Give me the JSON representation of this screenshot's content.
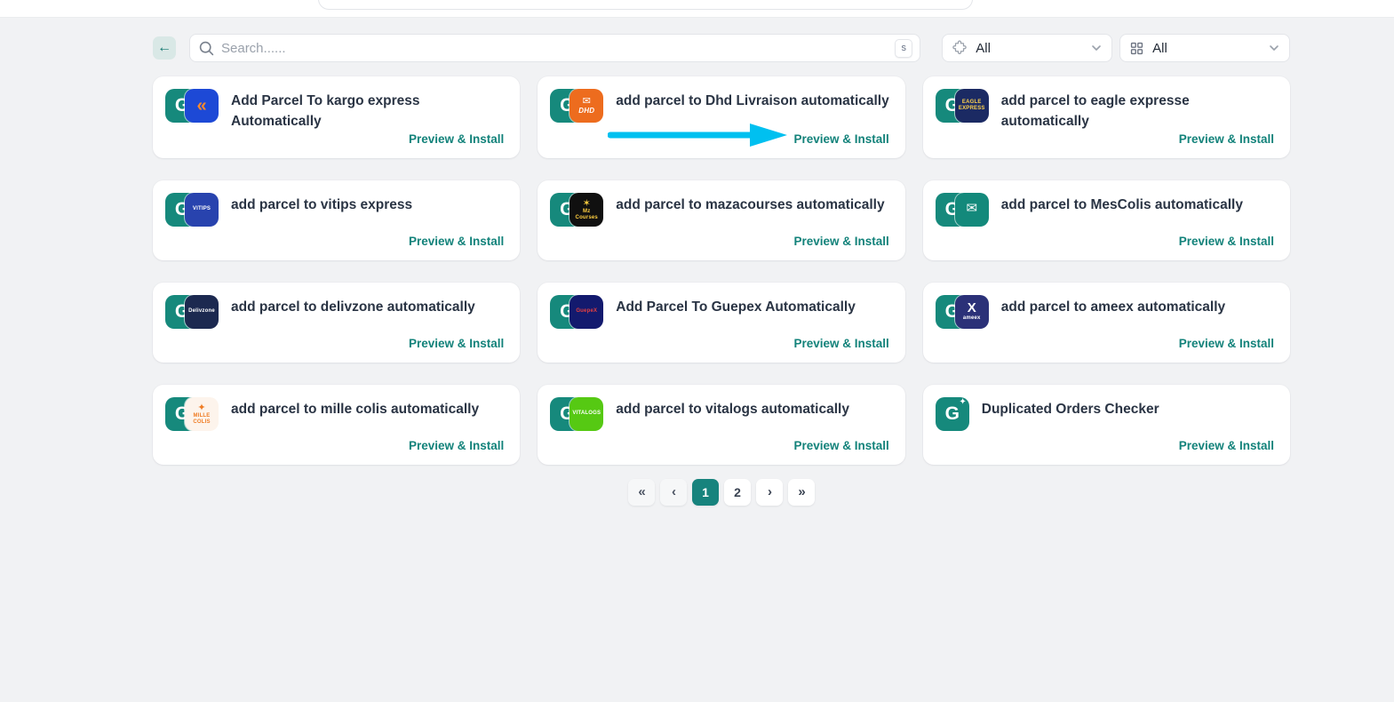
{
  "page": {
    "background": "#f1f2f4",
    "gitex_teal": "#16897c",
    "link_teal": "#12827a"
  },
  "topbar": {
    "back_label": "←",
    "search": {
      "placeholder": "Search......",
      "shortcut_key": "s"
    },
    "filters": [
      {
        "icon": "puzzle-icon",
        "value": "All"
      },
      {
        "icon": "grid-icon",
        "value": "All"
      }
    ]
  },
  "cards": [
    {
      "title": "Add Parcel To kargo express Automatically",
      "install_label": "Preview & Install",
      "partner": {
        "name": "kargo express",
        "bg": "#1d49d6",
        "fg": "#ff8a2a",
        "glyph": "«",
        "label": ""
      }
    },
    {
      "title": "add parcel to Dhd Livraison automatically",
      "install_label": "Preview & Install",
      "annotated": true,
      "partner": {
        "name": "Dhd Livraison",
        "bg": "#ed6c1e",
        "fg": "#ffffff",
        "glyph": "✉",
        "label": "DHD"
      }
    },
    {
      "title": "add parcel to eagle expresse automatically",
      "install_label": "Preview & Install",
      "partner": {
        "name": "eagle expresse",
        "bg": "#1b2a63",
        "fg": "#ffd34d",
        "glyph": "",
        "label": "EAGLE EXPRESS"
      }
    },
    {
      "title": "add parcel to vitips express",
      "install_label": "Preview & Install",
      "partner": {
        "name": "vitips express",
        "bg": "#2843ae",
        "fg": "#ffffff",
        "glyph": "",
        "label": "VITIPS"
      }
    },
    {
      "title": "add parcel to mazacourses automatically",
      "install_label": "Preview & Install",
      "partner": {
        "name": "mazacourses",
        "bg": "#101010",
        "fg": "#ffcf40",
        "glyph": "✶",
        "label": "Mz Courses"
      }
    },
    {
      "title": "add parcel to MesColis automatically",
      "install_label": "Preview & Install",
      "partner": {
        "name": "MesColis",
        "bg": "#13897b",
        "fg": "#ffffff",
        "glyph": "✉",
        "label": ""
      }
    },
    {
      "title": "add parcel to delivzone automatically",
      "install_label": "Preview & Install",
      "partner": {
        "name": "delivzone",
        "bg": "#1c2950",
        "fg": "#ffffff",
        "glyph": "",
        "label": "Delivzone"
      }
    },
    {
      "title": "Add Parcel To Guepex Automatically",
      "install_label": "Preview & Install",
      "partner": {
        "name": "Guepex",
        "bg": "#131a6e",
        "fg": "#e64040",
        "glyph": "",
        "label": "GuepeX"
      }
    },
    {
      "title": "add parcel to ameex automatically",
      "install_label": "Preview & Install",
      "partner": {
        "name": "ameex",
        "bg": "#2b3178",
        "fg": "#ffffff",
        "glyph": "X",
        "label": "ameex"
      }
    },
    {
      "title": "add parcel to mille colis automatically",
      "install_label": "Preview & Install",
      "partner": {
        "name": "mille colis",
        "bg": "#fdf4ec",
        "fg": "#ef7c24",
        "glyph": "✦",
        "label": "MILLE COLIS"
      }
    },
    {
      "title": "add parcel to vitalogs automatically",
      "install_label": "Preview & Install",
      "partner": {
        "name": "vitalogs",
        "bg": "#56c913",
        "fg": "#ffffff",
        "glyph": "",
        "label": "VITALOGS"
      }
    },
    {
      "title": "Duplicated Orders Checker",
      "install_label": "Preview & Install",
      "partner": null
    }
  ],
  "annotation": {
    "type": "arrow-right",
    "color": "#00c0f0"
  },
  "pagination": {
    "first": "«",
    "prev": "‹",
    "pages": [
      "1",
      "2"
    ],
    "active": "1",
    "next": "›",
    "last": "»"
  }
}
